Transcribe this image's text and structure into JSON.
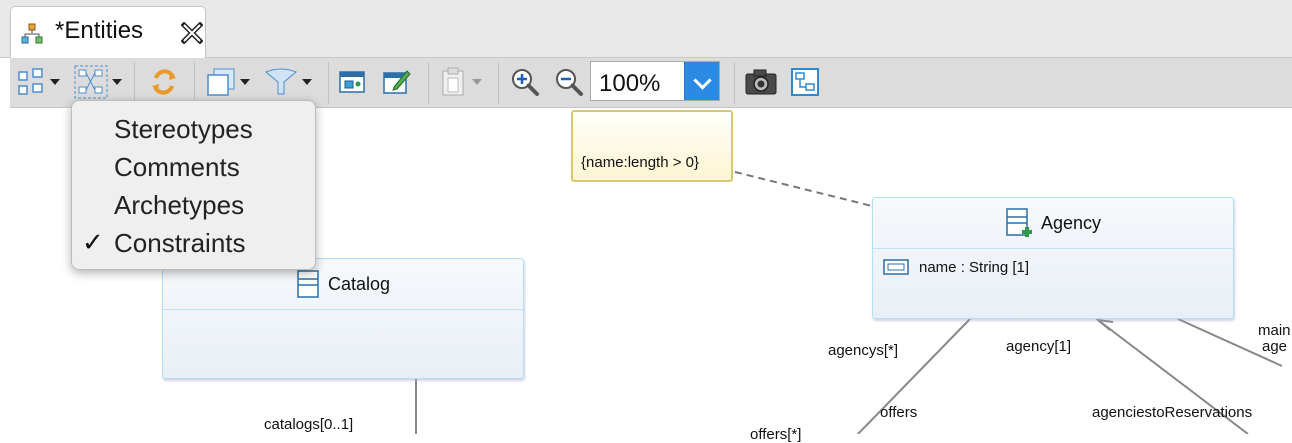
{
  "editor_tab": {
    "title": "*Entities",
    "icon": "model-icon",
    "close_icon": "close-icon"
  },
  "toolbar": {
    "zoom": "100%",
    "icons": [
      "layout-icon",
      "filter-icon",
      "refresh-icon",
      "view-icon",
      "funnel-icon",
      "show-all-icon",
      "edit-icon",
      "paste-icon",
      "zoom-in-icon",
      "zoom-out-icon",
      "camera-icon",
      "diagram-icon"
    ]
  },
  "filter_menu": {
    "items": [
      {
        "label": "Stereotypes",
        "checked": false
      },
      {
        "label": "Comments",
        "checked": false
      },
      {
        "label": "Archetypes",
        "checked": false
      },
      {
        "label": "Constraints",
        "checked": true
      }
    ],
    "check_glyph": "✓"
  },
  "diagram": {
    "note": {
      "text": "{name:length > 0}"
    },
    "classes": {
      "agency": {
        "name": "Agency",
        "attribute": "name : String [1]"
      },
      "catalog": {
        "name": "Catalog"
      }
    },
    "labels": {
      "agencys": "agencys[*]",
      "agency": "agency[1]",
      "offers": "offers",
      "offers_mult": "offers[*]",
      "agenciesto": "agenciestoReservations",
      "catalogs": "catalogs[0..1]",
      "main_a": "main",
      "main_b": "age"
    }
  },
  "colors": {
    "accent": "#2b8ae3",
    "class_border": "#b4def2",
    "note_border": "#d8c970"
  }
}
